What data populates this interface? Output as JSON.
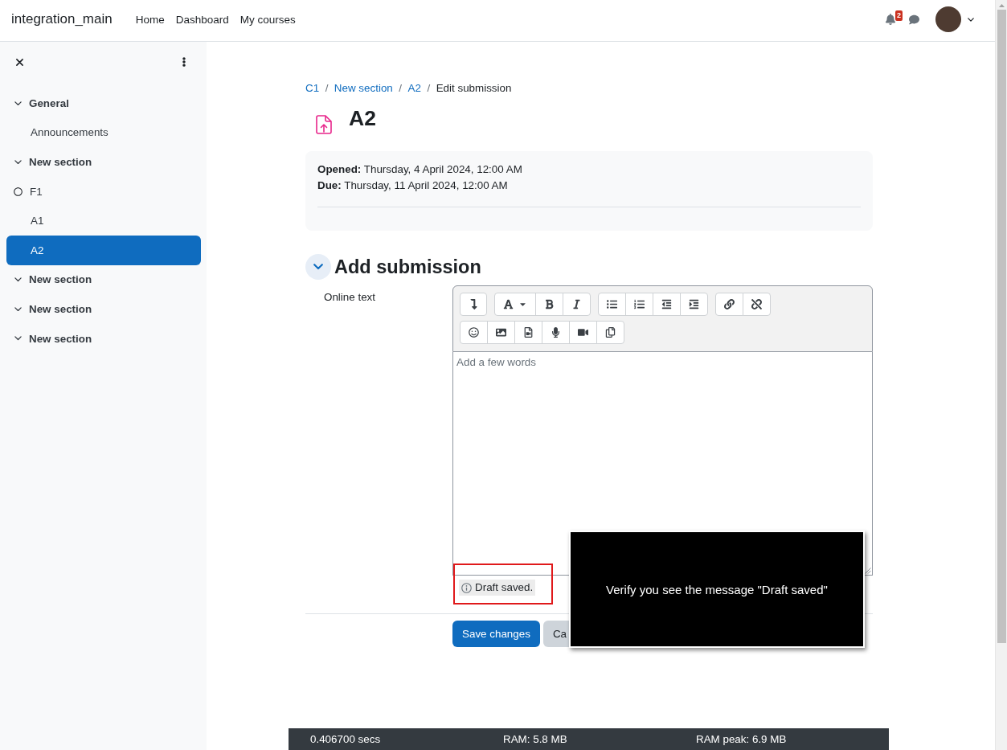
{
  "navbar": {
    "brand": "integration_main",
    "links": [
      "Home",
      "Dashboard",
      "My courses"
    ],
    "notification_count": "2"
  },
  "sidebar": {
    "sections": [
      {
        "title": "General",
        "expanded": true,
        "children": [
          {
            "label": "Announcements",
            "selected": false
          }
        ]
      },
      {
        "title": "New section",
        "expanded": true,
        "children": [
          {
            "label": "F1",
            "selected": false,
            "completed": false
          },
          {
            "label": "A1",
            "selected": false
          },
          {
            "label": "A2",
            "selected": true
          }
        ]
      },
      {
        "title": "New section",
        "expanded": true
      },
      {
        "title": "New section",
        "expanded": true
      },
      {
        "title": "New section",
        "expanded": true
      }
    ]
  },
  "breadcrumb": {
    "separator": "/",
    "items": [
      {
        "label": "C1",
        "link": true
      },
      {
        "label": "New section",
        "link": true
      },
      {
        "label": "A2",
        "link": true
      },
      {
        "label": "Edit submission",
        "link": false
      }
    ]
  },
  "page": {
    "title": "A2"
  },
  "dates": [
    "**Opened:** Thursday, 4 April 2024, 12:00 AM",
    "**Due:** Thursday, 11 April 2024, 12:00 AM"
  ],
  "submission": {
    "title": "Add submission",
    "expanded": true,
    "field_label": "Online text",
    "placeholder": "Add a few words",
    "draft_status": "Draft saved.",
    "highlight_frame": true
  },
  "buttons": [
    {
      "label": "Save changes",
      "kind": "primary"
    },
    {
      "label": "Ca",
      "kind": "secondary"
    }
  ],
  "overlay": {
    "message": "Verify you see the message \"Draft saved\""
  },
  "footer": [
    "0.406700 secs",
    "RAM: 5.8 MB",
    "RAM peak: 6.9 MB"
  ]
}
